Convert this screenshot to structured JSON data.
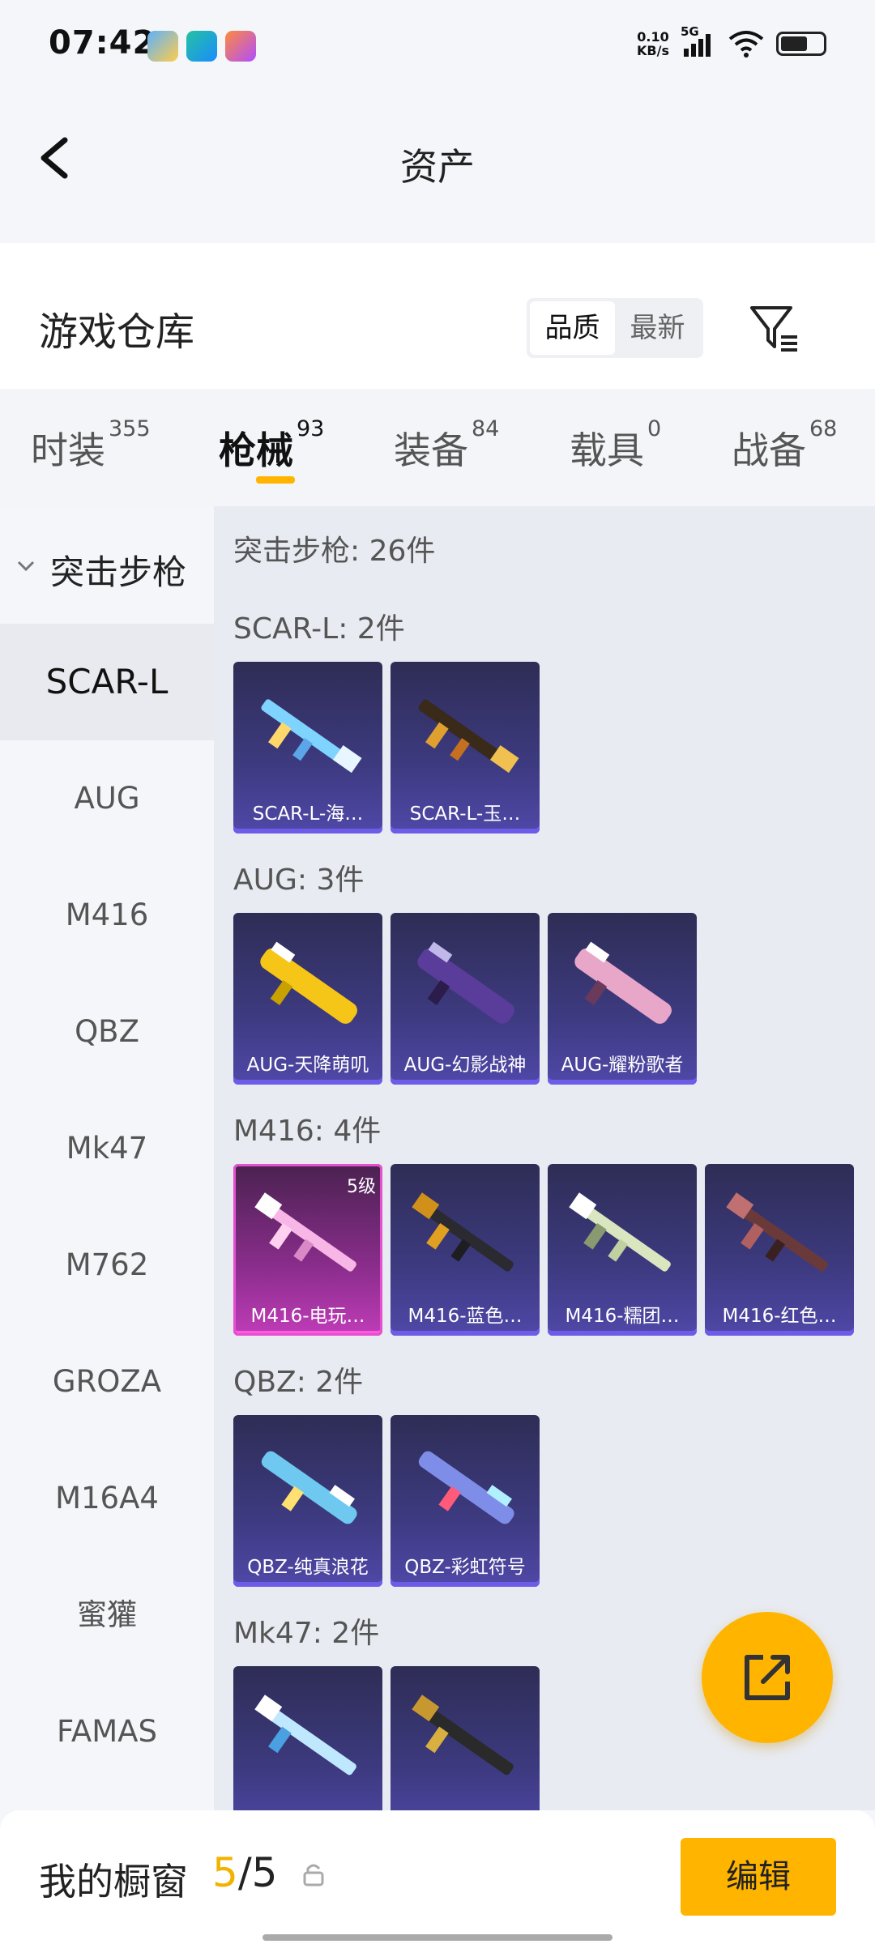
{
  "status_bar": {
    "time": "07:42",
    "net_speed_value": "0.10",
    "net_speed_unit": "KB/s",
    "network": "5G"
  },
  "header": {
    "title": "资产"
  },
  "warehouse": {
    "title": "游戏仓库",
    "sort_options": [
      "品质",
      "最新"
    ],
    "active_sort": "品质"
  },
  "tabs": [
    {
      "label": "时装",
      "count": "355"
    },
    {
      "label": "枪械",
      "count": "93",
      "active": true
    },
    {
      "label": "装备",
      "count": "84"
    },
    {
      "label": "载具",
      "count": "0"
    },
    {
      "label": "战备",
      "count": "68"
    }
  ],
  "sidebar": {
    "category": "突击步枪",
    "items": [
      "SCAR-L",
      "AUG",
      "M416",
      "QBZ",
      "Mk47",
      "M762",
      "GROZA",
      "M16A4",
      "蜜獾",
      "FAMAS"
    ],
    "active": "SCAR-L"
  },
  "content": {
    "summary": "突击步枪: 26件",
    "groups": [
      {
        "title": "SCAR-L: 2件",
        "items": [
          {
            "name": "SCAR-L-海…"
          },
          {
            "name": "SCAR-L-玉…"
          }
        ]
      },
      {
        "title": "AUG: 3件",
        "items": [
          {
            "name": "AUG-天降萌叽"
          },
          {
            "name": "AUG-幻影战神"
          },
          {
            "name": "AUG-耀粉歌者"
          }
        ]
      },
      {
        "title": "M416: 4件",
        "items": [
          {
            "name": "M416-电玩…",
            "level": "5级"
          },
          {
            "name": "M416-蓝色…"
          },
          {
            "name": "M416-糯团…"
          },
          {
            "name": "M416-红色…"
          }
        ]
      },
      {
        "title": "QBZ: 2件",
        "items": [
          {
            "name": "QBZ-纯真浪花"
          },
          {
            "name": "QBZ-彩虹符号"
          }
        ]
      },
      {
        "title": "Mk47: 2件",
        "items": [
          {
            "name": ""
          },
          {
            "name": ""
          }
        ]
      }
    ]
  },
  "bottom_bar": {
    "label": "我的橱窗",
    "current": "5",
    "separator": "/",
    "total": "5",
    "edit_label": "编辑"
  },
  "colors": {
    "accent": "#ffb400",
    "card_bg": "#3d3a80",
    "card_pink": "#c03cb8"
  }
}
